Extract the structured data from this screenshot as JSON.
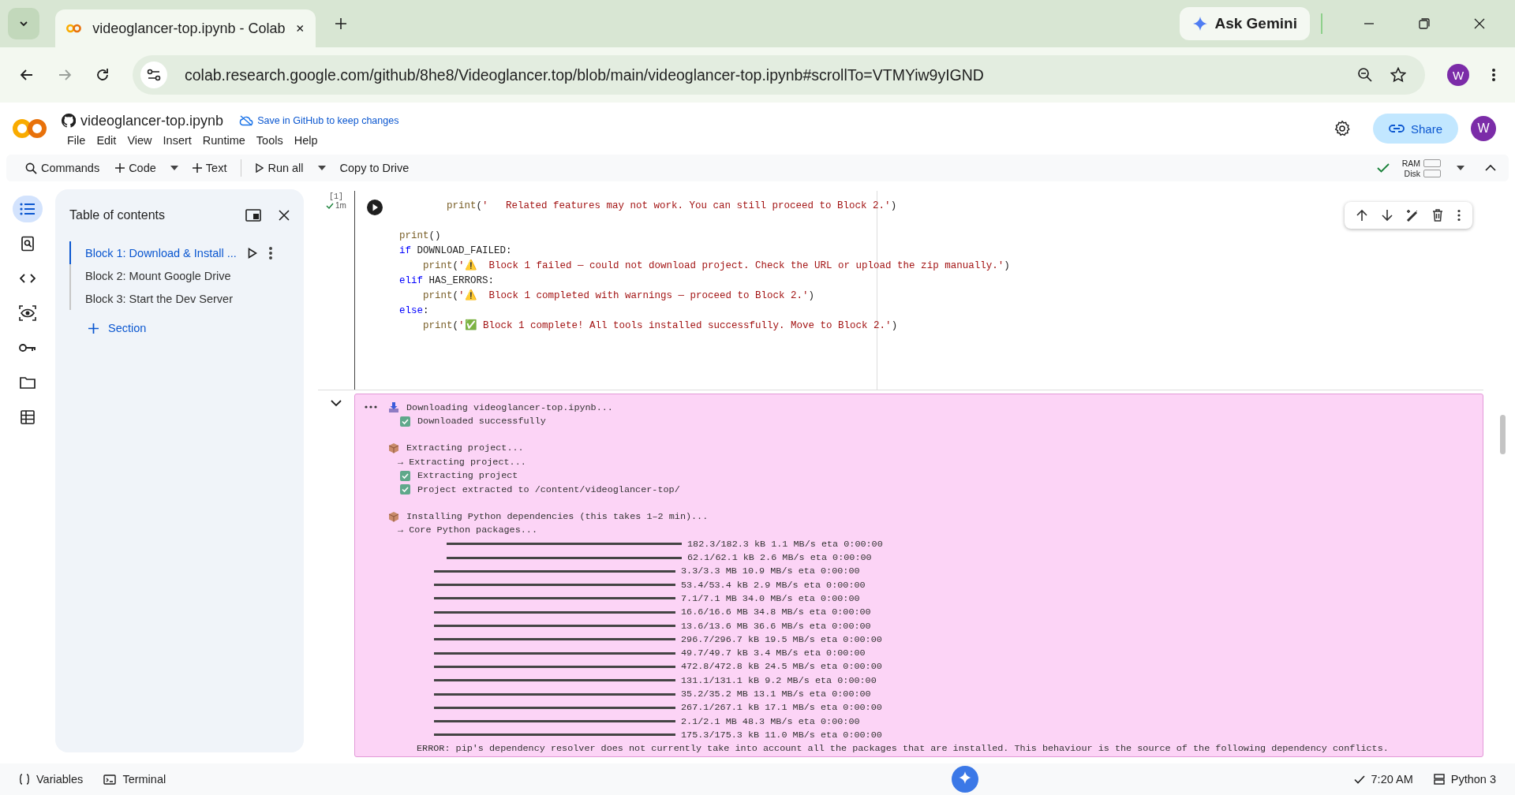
{
  "browser": {
    "tab_title": "videoglancer-top.ipynb - Colab",
    "ask_gemini": "Ask Gemini",
    "url_host": "colab.research.google.com",
    "url_path": "/github/8he8/Videoglancer.top/blob/main/videoglancer-top.ipynb#scrollTo=VTMYiw9yIGND",
    "profile": "W"
  },
  "header": {
    "notebook_title": "videoglancer-top.ipynb",
    "save_hint": "Save in GitHub to keep changes",
    "share": "Share",
    "avatar": "W",
    "menu": [
      "File",
      "Edit",
      "View",
      "Insert",
      "Runtime",
      "Tools",
      "Help"
    ]
  },
  "toolbar": {
    "commands": "Commands",
    "code": "Code",
    "text": "Text",
    "run_all": "Run all",
    "copy": "Copy to Drive",
    "ram": "RAM",
    "disk": "Disk"
  },
  "toc": {
    "title": "Table of contents",
    "items": [
      {
        "label": "Block 1: Download & Install ...",
        "selected": true
      },
      {
        "label": "Block 2: Mount Google Drive",
        "selected": false
      },
      {
        "label": "Block 3: Start the Dev Server",
        "selected": false
      }
    ],
    "add_section": "Section"
  },
  "cell": {
    "exec_count": "[1]",
    "duration": "1m",
    "lines": [
      {
        "kind": "indent-2",
        "text": "print('   Related features may not work. You can still proceed to Block 2.')"
      },
      {
        "kind": "after-blank",
        "text": "print()"
      },
      {
        "kind": "keyword",
        "text": "if DOWNLOAD_FAILED:"
      },
      {
        "kind": "indent-1",
        "text": "print('⚠️  Block 1 failed — could not download project. Check the URL or upload the zip manually.')"
      },
      {
        "kind": "keyword",
        "text": "elif HAS_ERRORS:"
      },
      {
        "kind": "indent-1",
        "text": "print('⚠️  Block 1 completed with warnings — proceed to Block 2.')"
      },
      {
        "kind": "keyword",
        "text": "else:"
      },
      {
        "kind": "indent-1",
        "text": "print('✅ Block 1 complete! All tools installed successfully. Move to Block 2.')"
      }
    ],
    "output": [
      {
        "kind": "download",
        "text": "Downloading videoglancer-top.ipynb..."
      },
      {
        "kind": "check",
        "text": "Downloaded successfully"
      },
      {
        "kind": "step",
        "text": "Extracting project..."
      },
      {
        "kind": "sub",
        "text": "→ Extracting project..."
      },
      {
        "kind": "check",
        "text": "Extracting project"
      },
      {
        "kind": "check",
        "text": "Project extracted to /content/videoglancer-top/"
      },
      {
        "kind": "step",
        "text": "Installing Python dependencies (this takes 1–2 min)..."
      },
      {
        "kind": "sub",
        "text": "→ Core Python packages..."
      },
      {
        "kind": "bar-inset",
        "level": 1,
        "text": "182.3/182.3 kB 1.1 MB/s eta 0:00:00"
      },
      {
        "kind": "bar-inset",
        "level": 1,
        "text": "62.1/62.1 kB 2.6 MB/s eta 0:00:00"
      },
      {
        "kind": "bar",
        "level": 1,
        "text": "3.3/3.3 MB 10.9 MB/s eta 0:00:00"
      },
      {
        "kind": "bar",
        "level": 1,
        "text": "53.4/53.4 kB 2.9 MB/s eta 0:00:00"
      },
      {
        "kind": "bar",
        "level": 1,
        "text": "7.1/7.1 MB 34.0 MB/s eta 0:00:00"
      },
      {
        "kind": "bar",
        "level": 1,
        "text": "16.6/16.6 MB 34.8 MB/s eta 0:00:00"
      },
      {
        "kind": "bar",
        "level": 1,
        "text": "13.6/13.6 MB 36.6 MB/s eta 0:00:00"
      },
      {
        "kind": "bar",
        "level": 1,
        "text": "296.7/296.7 kB 19.5 MB/s eta 0:00:00"
      },
      {
        "kind": "bar",
        "level": 1,
        "text": "49.7/49.7 kB 3.4 MB/s eta 0:00:00"
      },
      {
        "kind": "bar",
        "level": 1,
        "text": "472.8/472.8 kB 24.5 MB/s eta 0:00:00"
      },
      {
        "kind": "bar",
        "level": 1,
        "text": "131.1/131.1 kB 9.2 MB/s eta 0:00:00"
      },
      {
        "kind": "bar",
        "level": 1,
        "text": "35.2/35.2 MB 13.1 MB/s eta 0:00:00"
      },
      {
        "kind": "bar",
        "level": 1,
        "text": "267.1/267.1 kB 17.1 MB/s eta 0:00:00"
      },
      {
        "kind": "bar",
        "level": 1,
        "text": "2.1/2.1 MB 48.3 MB/s eta 0:00:00"
      },
      {
        "kind": "bar",
        "level": 1,
        "text": "175.3/175.3 kB 11.0 MB/s eta 0:00:00"
      },
      {
        "kind": "error",
        "text": "ERROR: pip's dependency resolver does not currently take into account all the packages that are installed. This behaviour is the source of the following dependency conflicts."
      }
    ]
  },
  "status_bar": {
    "variables": "Variables",
    "terminal": "Terminal",
    "time": "7:20 AM",
    "runtime": "Python 3"
  }
}
